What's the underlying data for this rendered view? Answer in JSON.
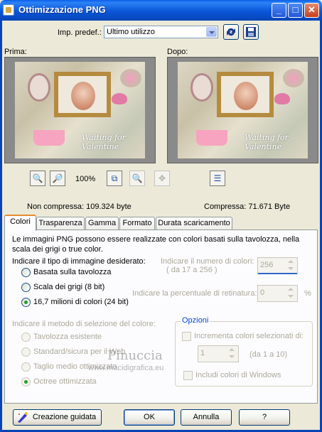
{
  "window": {
    "title": "Ottimizzazione PNG"
  },
  "titlebar_buttons": {
    "minimize": "_",
    "maximize": "□",
    "close": "✕"
  },
  "preset": {
    "label": "Imp. predef.:",
    "value": "Ultimo utilizzo"
  },
  "preview": {
    "before_label": "Prima:",
    "after_label": "Dopo:",
    "zoom": "100%",
    "image_text": "Waiting for Valentine",
    "uncompressed": "Non compressa: 109.324 byte",
    "compressed": "Compressa: 71.671 Byte"
  },
  "tabs": [
    "Colori",
    "Trasparenza",
    "Gamma",
    "Formato",
    "Durata scaricamento"
  ],
  "colors_tab": {
    "description": "Le immagini PNG possono essere realizzate con colori basati sulla tavolozza, nella scala dei grigi o true color.",
    "type_prompt": "Indicare il tipo di immagine desiderato:",
    "type_options": [
      "Basata sulla tavolozza",
      "Scala dei grigi (8 bit)",
      "16,7 milioni di colori (24 bit)"
    ],
    "num_colors_label": "Indicare il numero di colori:",
    "num_colors_range": "( da 17  a   256 )",
    "num_colors_value": "256",
    "dither_label": "Indicare la percentuale di retinatura:",
    "dither_value": "0",
    "dither_unit": "%",
    "method_prompt": "Indicare il metodo di selezione del colore:",
    "method_options": [
      "Tavolozza esistente",
      "Standard/sicura per il Web",
      "Taglio medio ottimizzato",
      "Octree ottimizzata"
    ],
    "options_group": {
      "title": "Opzioni",
      "increase_label": "Incrementa colori selezionati di:",
      "increase_value": "1",
      "increase_range": "(da 1 a 10)",
      "windows_colors_label": "Includi colori di Windows"
    }
  },
  "watermark": {
    "name": "Pinuccia",
    "site": "www.macidigrafica.eu"
  },
  "buttons": {
    "wizard": "Creazione guidata",
    "ok": "OK",
    "cancel": "Annulla",
    "help": "?"
  }
}
